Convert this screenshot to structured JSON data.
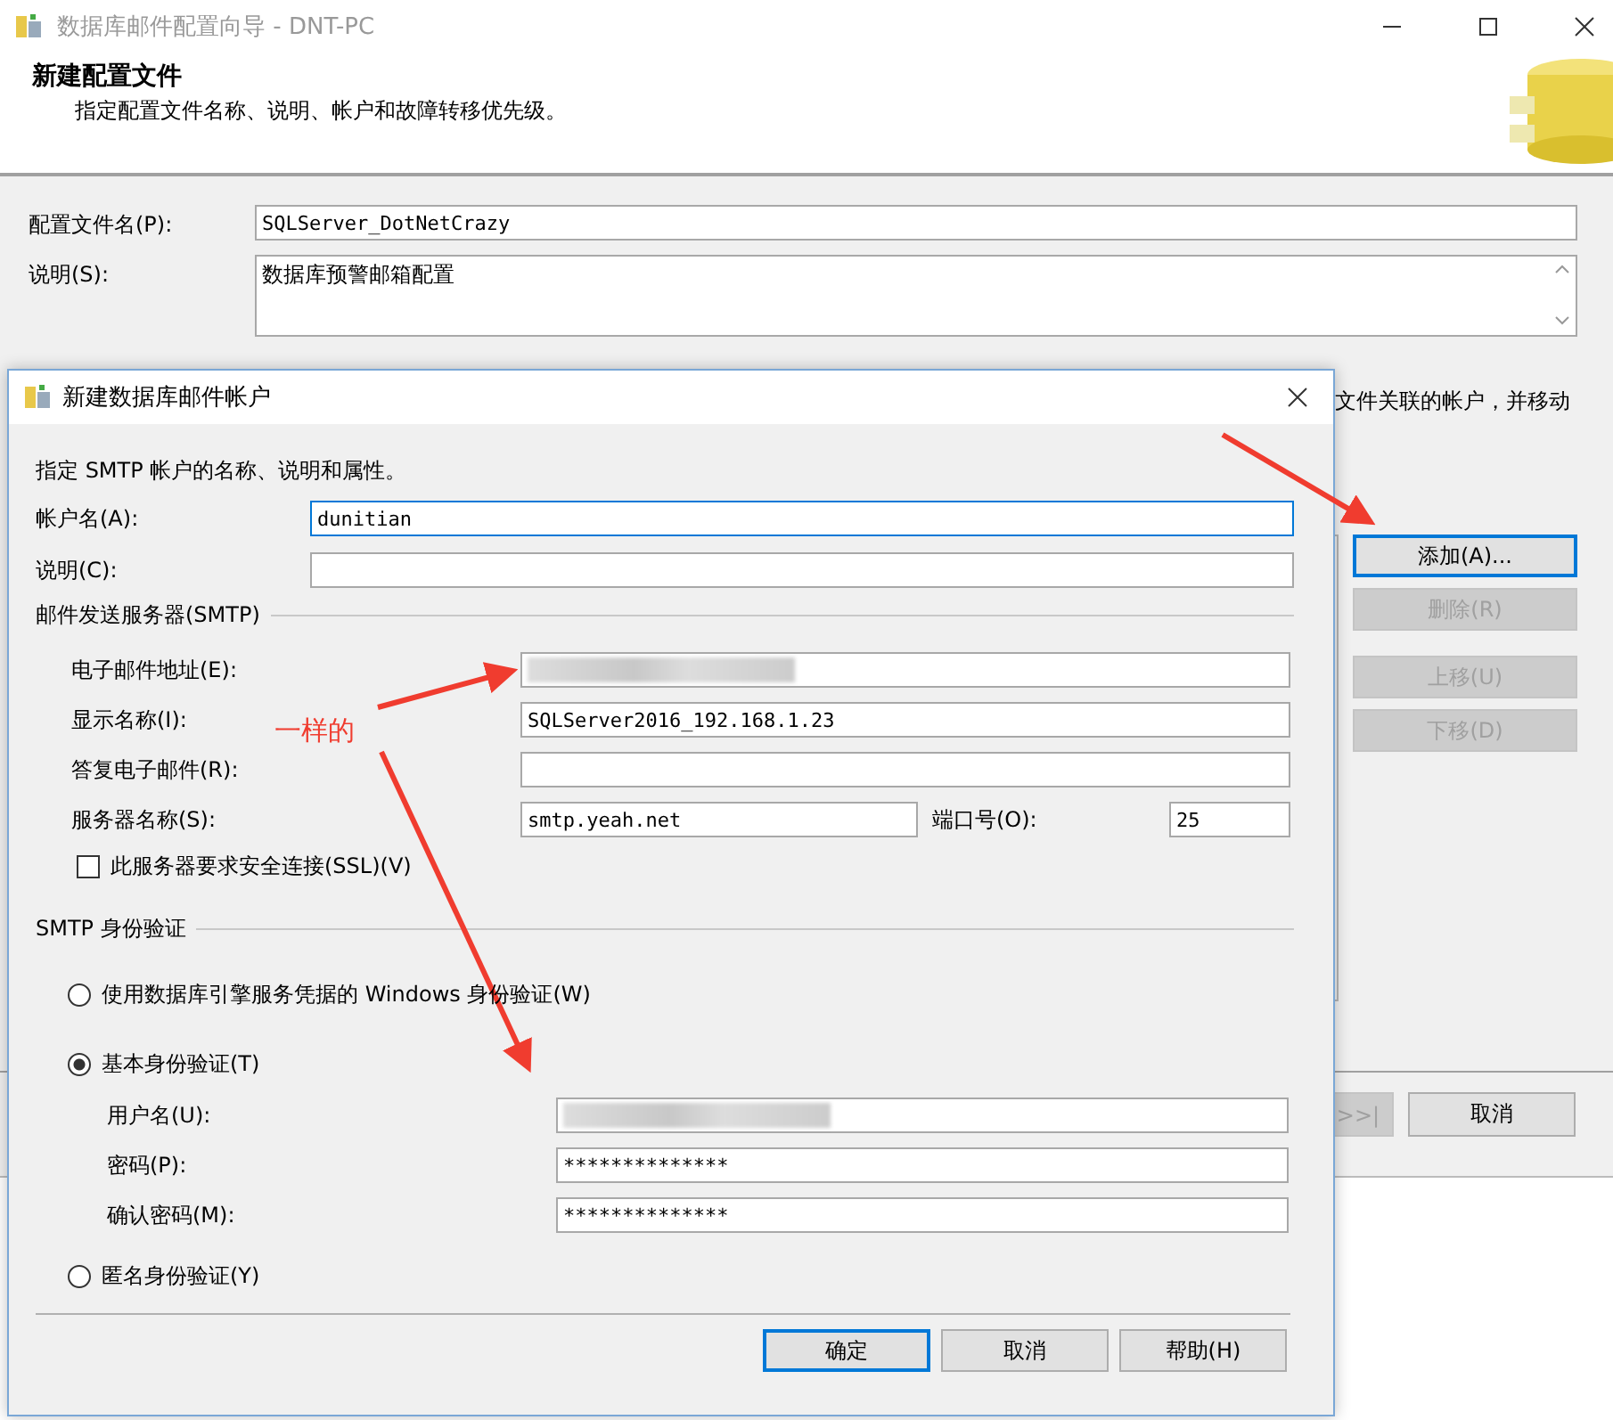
{
  "window": {
    "title": "数据库邮件配置向导 - DNT-PC"
  },
  "header": {
    "title": "新建配置文件",
    "subtitle": "指定配置文件名称、说明、帐户和故障转移优先级。"
  },
  "profile_fields": [
    {
      "kind": "line",
      "label": "配置文件名(P):",
      "value": "SQLServer_DotNetCrazy"
    },
    {
      "kind": "multiline",
      "label": "说明(S):",
      "value": "数据库预警邮箱配置"
    }
  ],
  "accounts_note": "文件关联的帐户，并移动",
  "account_buttons": [
    {
      "label": "添加(A)...",
      "disabled": false,
      "focused": true
    },
    {
      "label": "删除(R)",
      "disabled": true,
      "focused": false
    },
    {
      "label": "上移(U)",
      "disabled": true,
      "focused": false
    },
    {
      "label": "下移(D)",
      "disabled": true,
      "focused": false
    }
  ],
  "footer_buttons": [
    {
      "label": ">>|",
      "disabled": true
    },
    {
      "label": "取消",
      "disabled": false
    }
  ],
  "dialog": {
    "title": "新建数据库邮件帐户",
    "instruction": "指定 SMTP 帐户的名称、说明和属性。",
    "account_fields": [
      {
        "label": "帐户名(A):",
        "value": "dunitian",
        "focused": true
      },
      {
        "label": "说明(C):",
        "focused": false
      }
    ],
    "smtp": {
      "title": "邮件发送服务器(SMTP)",
      "fields": [
        {
          "label": "电子邮件地址(E):",
          "redacted": true
        },
        {
          "label": "显示名称(I):",
          "value": "SQLServer2016_192.168.1.23",
          "redacted": false
        },
        {
          "label": "答复电子邮件(R):",
          "redacted": false
        }
      ],
      "server": {
        "label": "服务器名称(S):",
        "value": "smtp.yeah.net"
      },
      "port": {
        "label": "端口号(O):",
        "value": "25"
      },
      "ssl": {
        "label": "此服务器要求安全连接(SSL)(V)",
        "checked": false
      }
    },
    "auth": {
      "title": "SMTP 身份验证",
      "options": [
        {
          "label": "使用数据库引擎服务凭据的 Windows 身份验证(W)",
          "selected": false
        },
        {
          "label": "基本身份验证(T)",
          "selected": true
        },
        {
          "label": "匿名身份验证(Y)",
          "selected": false
        }
      ],
      "fields": [
        {
          "label": "用户名(U):",
          "redacted": true
        },
        {
          "label": "密码(P):",
          "value": "**************",
          "redacted": false
        },
        {
          "label": "确认密码(M):",
          "value": "**************",
          "redacted": false
        }
      ]
    },
    "buttons": [
      {
        "label": "确定",
        "default": true
      },
      {
        "label": "取消",
        "default": false
      },
      {
        "label": "帮助(H)",
        "default": false
      }
    ]
  },
  "annotation": {
    "text": "一样的"
  }
}
